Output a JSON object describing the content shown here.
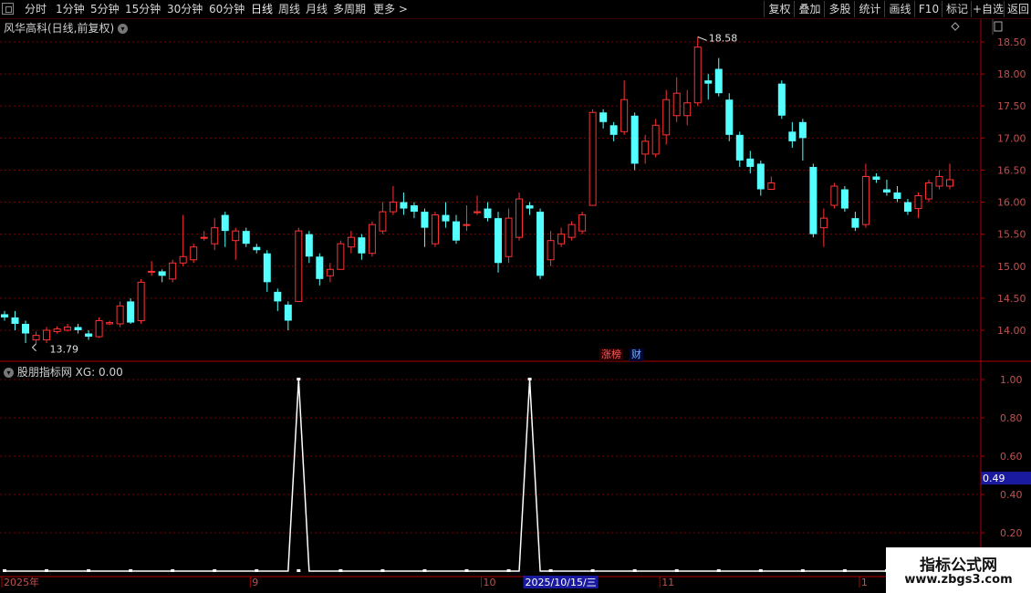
{
  "toolbar": {
    "periods": [
      "分时",
      "1分钟",
      "5分钟",
      "15分钟",
      "30分钟",
      "60分钟",
      "日线",
      "周线",
      "月线",
      "多周期",
      "更多 >"
    ],
    "active_period": "日线",
    "right_buttons": [
      "复权",
      "叠加",
      "多股",
      "统计",
      "画线",
      "F10",
      "标记",
      "+自选",
      "返回"
    ]
  },
  "main_chart": {
    "title": "风华高科(日线,前复权)",
    "high_label": "18.58",
    "low_label": "13.79",
    "tags": [
      {
        "text": "涨榜",
        "color": "#ff5a5a"
      },
      {
        "text": "财",
        "color": "#7ab0ff"
      }
    ]
  },
  "indicator": {
    "title": "股朋指标网 XG: 0.00",
    "current_value_label": "0.49"
  },
  "watermark": {
    "line1": "指标公式网",
    "line2": "www.zbgs3.com"
  },
  "colors": {
    "up": "#ff3232",
    "down": "#54ffff",
    "grid": "#7a0000",
    "axis": "#b00000",
    "bg": "#000000",
    "highlight": "#1a1aa0"
  },
  "chart_data": [
    {
      "type": "candlestick",
      "title": "风华高科(日线,前复权)",
      "y_ticks": [
        14.0,
        14.5,
        15.0,
        15.5,
        16.0,
        16.5,
        17.0,
        17.5,
        18.0,
        18.5
      ],
      "ylim": [
        13.65,
        18.75
      ],
      "high": 18.58,
      "low": 13.79,
      "candles": [
        [
          14.25,
          14.2,
          14.3,
          14.15
        ],
        [
          14.2,
          14.1,
          14.3,
          14.0
        ],
        [
          14.1,
          13.95,
          14.15,
          13.8
        ],
        [
          13.85,
          13.92,
          13.98,
          13.79
        ],
        [
          13.85,
          14.0,
          14.05,
          13.8
        ],
        [
          13.98,
          14.02,
          14.06,
          13.95
        ],
        [
          14.0,
          14.05,
          14.1,
          13.98
        ],
        [
          14.05,
          14.0,
          14.1,
          13.95
        ],
        [
          13.95,
          13.9,
          14.0,
          13.85
        ],
        [
          13.9,
          14.15,
          14.2,
          13.88
        ],
        [
          14.1,
          14.12,
          14.15,
          14.08
        ],
        [
          14.1,
          14.38,
          14.45,
          14.05
        ],
        [
          14.45,
          14.12,
          14.5,
          14.1
        ],
        [
          14.15,
          14.75,
          14.8,
          14.1
        ],
        [
          14.92,
          14.92,
          15.08,
          14.85
        ],
        [
          14.92,
          14.85,
          14.95,
          14.75
        ],
        [
          14.8,
          15.05,
          15.1,
          14.75
        ],
        [
          15.05,
          15.15,
          15.8,
          15.0
        ],
        [
          15.1,
          15.3,
          15.35,
          15.05
        ],
        [
          15.45,
          15.45,
          15.55,
          15.4
        ],
        [
          15.35,
          15.6,
          15.75,
          15.25
        ],
        [
          15.8,
          15.55,
          15.85,
          15.3
        ],
        [
          15.4,
          15.55,
          15.6,
          15.1
        ],
        [
          15.55,
          15.35,
          15.6,
          15.3
        ],
        [
          15.3,
          15.25,
          15.35,
          15.2
        ],
        [
          15.2,
          14.75,
          15.25,
          14.6
        ],
        [
          14.6,
          14.45,
          14.65,
          14.3
        ],
        [
          14.4,
          14.15,
          14.45,
          14.0
        ],
        [
          14.45,
          15.55,
          15.6,
          14.45
        ],
        [
          15.5,
          15.15,
          15.55,
          15.05
        ],
        [
          15.15,
          14.8,
          15.2,
          14.7
        ],
        [
          14.85,
          14.95,
          15.05,
          14.75
        ],
        [
          14.95,
          15.35,
          15.4,
          14.95
        ],
        [
          15.3,
          15.45,
          15.55,
          15.2
        ],
        [
          15.45,
          15.2,
          15.5,
          15.1
        ],
        [
          15.2,
          15.65,
          15.7,
          15.15
        ],
        [
          15.55,
          15.85,
          16.0,
          15.5
        ],
        [
          15.85,
          16.0,
          16.25,
          15.8
        ],
        [
          16.0,
          15.9,
          16.15,
          15.8
        ],
        [
          15.95,
          15.85,
          16.0,
          15.75
        ],
        [
          15.85,
          15.6,
          15.9,
          15.3
        ],
        [
          15.35,
          15.8,
          15.85,
          15.3
        ],
        [
          15.8,
          15.7,
          16.0,
          15.6
        ],
        [
          15.7,
          15.4,
          15.8,
          15.35
        ],
        [
          15.65,
          15.65,
          15.95,
          15.55
        ],
        [
          15.85,
          15.85,
          16.1,
          15.8
        ],
        [
          15.9,
          15.75,
          16.0,
          15.7
        ],
        [
          15.75,
          15.05,
          15.85,
          14.9
        ],
        [
          15.15,
          15.75,
          15.9,
          15.05
        ],
        [
          15.45,
          16.05,
          16.15,
          15.4
        ],
        [
          15.95,
          15.9,
          16.0,
          15.8
        ],
        [
          15.85,
          14.85,
          15.9,
          14.8
        ],
        [
          15.1,
          15.4,
          15.55,
          15.0
        ],
        [
          15.35,
          15.5,
          15.6,
          15.3
        ],
        [
          15.45,
          15.65,
          15.7,
          15.4
        ],
        [
          15.55,
          15.8,
          15.85,
          15.5
        ],
        [
          15.95,
          17.4,
          17.45,
          15.95
        ],
        [
          17.4,
          17.25,
          17.45,
          17.15
        ],
        [
          17.2,
          17.05,
          17.25,
          16.95
        ],
        [
          17.1,
          17.6,
          17.9,
          17.05
        ],
        [
          17.35,
          16.6,
          17.4,
          16.5
        ],
        [
          16.75,
          16.95,
          17.05,
          16.6
        ],
        [
          16.75,
          17.2,
          17.3,
          16.7
        ],
        [
          17.05,
          17.6,
          17.75,
          16.9
        ],
        [
          17.35,
          17.7,
          17.95,
          17.25
        ],
        [
          17.35,
          17.55,
          17.75,
          17.2
        ],
        [
          17.55,
          18.42,
          18.58,
          17.5
        ],
        [
          17.9,
          17.85,
          18.0,
          17.6
        ],
        [
          18.08,
          17.7,
          18.25,
          17.65
        ],
        [
          17.6,
          17.05,
          17.7,
          16.95
        ],
        [
          17.05,
          16.65,
          17.1,
          16.55
        ],
        [
          16.68,
          16.55,
          16.8,
          16.45
        ],
        [
          16.6,
          16.2,
          16.65,
          16.1
        ],
        [
          16.2,
          16.3,
          16.4,
          16.2
        ],
        [
          17.85,
          17.35,
          17.9,
          17.3
        ],
        [
          17.1,
          16.95,
          17.25,
          16.85
        ],
        [
          17.25,
          17.0,
          17.3,
          16.65
        ],
        [
          16.55,
          15.5,
          16.6,
          15.45
        ],
        [
          15.6,
          15.75,
          15.9,
          15.3
        ],
        [
          15.95,
          16.25,
          16.3,
          15.9
        ],
        [
          16.2,
          15.9,
          16.25,
          15.85
        ],
        [
          15.75,
          15.6,
          15.85,
          15.55
        ],
        [
          15.65,
          16.4,
          16.6,
          15.6
        ],
        [
          16.4,
          16.35,
          16.45,
          16.3
        ],
        [
          16.2,
          16.15,
          16.35,
          16.1
        ],
        [
          16.15,
          16.05,
          16.25,
          16.0
        ],
        [
          16.0,
          15.85,
          16.05,
          15.8
        ],
        [
          15.9,
          16.1,
          16.15,
          15.75
        ],
        [
          16.05,
          16.3,
          16.35,
          16.0
        ],
        [
          16.25,
          16.4,
          16.5,
          16.2
        ],
        [
          16.25,
          16.35,
          16.6,
          16.2
        ]
      ]
    },
    {
      "type": "line",
      "title": "股朋指标网 XG: 0.00",
      "y_ticks": [
        0.2,
        0.4,
        0.6,
        0.8,
        1.0
      ],
      "signal_indices": [
        28,
        50
      ],
      "values_note": "0 everywhere except 1.00 at signal indices"
    }
  ],
  "x_axis": {
    "labels": [
      {
        "text": "2025年",
        "idx": 0
      },
      {
        "text": "9",
        "idx": 24
      },
      {
        "text": "10",
        "idx": 46
      },
      {
        "text": "2025/10/15/三",
        "idx": 50,
        "highlight": true
      },
      {
        "text": "11",
        "idx": 63
      },
      {
        "text": "1",
        "idx": 82
      }
    ]
  }
}
